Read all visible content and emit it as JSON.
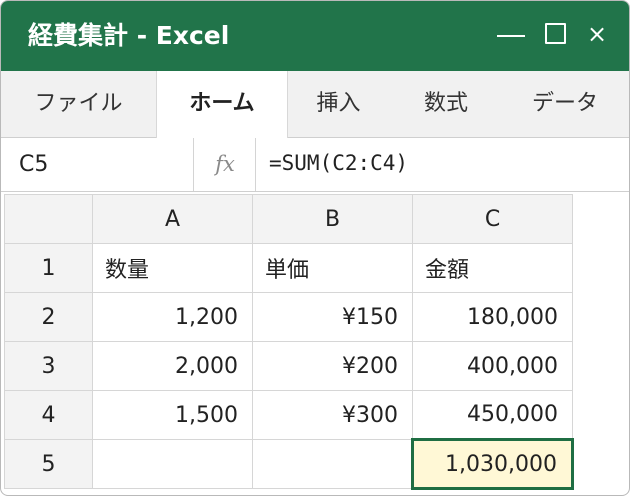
{
  "window": {
    "title": "経費集計 - Excel",
    "controls": {
      "close": "×"
    }
  },
  "ribbon": {
    "tabs": [
      {
        "label": "ファイル",
        "active": false
      },
      {
        "label": "ホーム",
        "active": true
      },
      {
        "label": "挿入",
        "active": false
      },
      {
        "label": "数式",
        "active": false
      },
      {
        "label": "データ",
        "active": false
      }
    ]
  },
  "formula_bar": {
    "name_box": "C5",
    "fx_label": "fx",
    "formula": "=SUM(C2:C4)"
  },
  "sheet": {
    "columns": [
      "A",
      "B",
      "C"
    ],
    "rows": [
      {
        "num": "1",
        "cells": [
          "数量",
          "単価",
          "金額"
        ]
      },
      {
        "num": "2",
        "cells": [
          "1,200",
          "¥150",
          "180,000"
        ]
      },
      {
        "num": "3",
        "cells": [
          "2,000",
          "¥200",
          "400,000"
        ]
      },
      {
        "num": "4",
        "cells": [
          "1,500",
          "¥300",
          "450,000"
        ]
      },
      {
        "num": "5",
        "cells": [
          "",
          "",
          "1,030,000"
        ]
      }
    ],
    "selected_cell": "C5"
  },
  "colors": {
    "title_bar": "#21744a",
    "selection_border": "#1f6e43",
    "selection_fill": "#fff8d6"
  }
}
